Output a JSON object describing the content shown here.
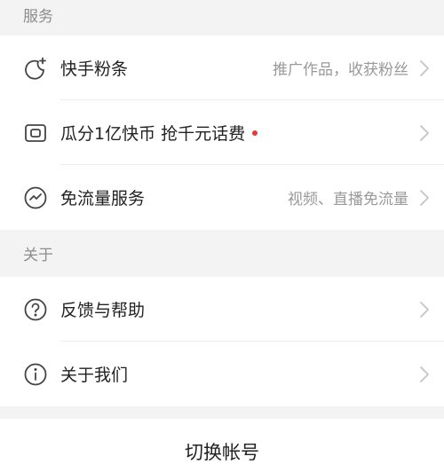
{
  "sections": {
    "service": {
      "header": "服务",
      "items": [
        {
          "label": "快手粉条",
          "hint": "推广作品，收获粉丝",
          "icon": "sparkle-moon-icon"
        },
        {
          "label": "瓜分1亿快币 抢千元话费",
          "hint": "",
          "icon": "coin-card-icon",
          "badge_color": "#e63a36"
        },
        {
          "label": "免流量服务",
          "hint": "视频、直播免流量",
          "icon": "wave-circle-icon"
        }
      ]
    },
    "about": {
      "header": "关于",
      "items": [
        {
          "label": "反馈与帮助",
          "icon": "question-circle-icon"
        },
        {
          "label": "关于我们",
          "icon": "info-circle-icon"
        }
      ]
    }
  },
  "switch_account": {
    "label": "切换帐号"
  }
}
